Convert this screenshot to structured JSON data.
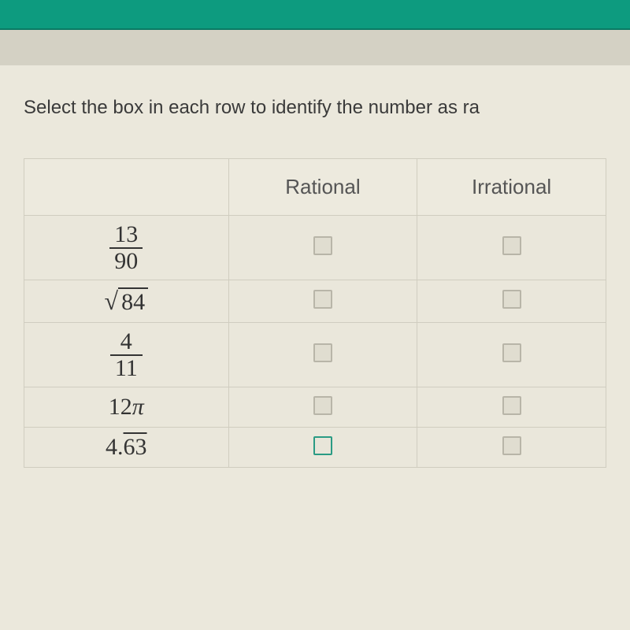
{
  "prompt": "Select the box in each row to identify the number as ra",
  "headers": {
    "blank": "",
    "rational": "Rational",
    "irrational": "Irrational"
  },
  "rows": [
    {
      "type": "fraction",
      "num": "13",
      "den": "90"
    },
    {
      "type": "sqrt",
      "radicand": "84"
    },
    {
      "type": "fraction",
      "num": "4",
      "den": "11"
    },
    {
      "type": "pi_mult",
      "coef": "12",
      "pi": "π"
    },
    {
      "type": "repeating",
      "whole": "4.",
      "rep": "63"
    }
  ]
}
